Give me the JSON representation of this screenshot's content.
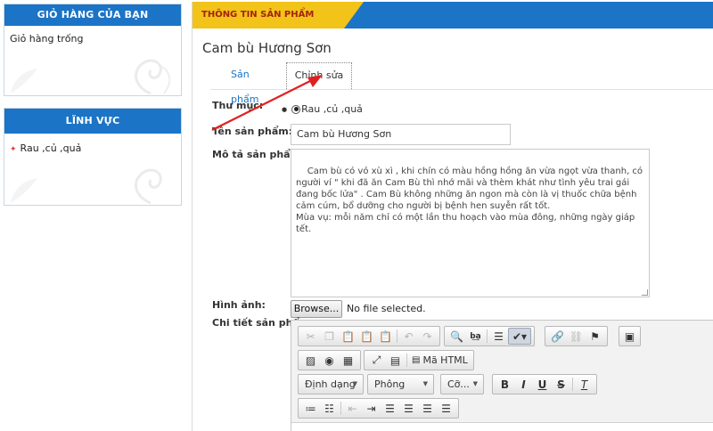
{
  "sidebar": {
    "cart": {
      "title": "GIỎ HÀNG CỦA BẠN",
      "empty_text": "Giỏ hàng trống"
    },
    "fields": {
      "title": "LĨNH VỰC",
      "items": [
        {
          "label": "Rau ,củ ,quả"
        }
      ]
    }
  },
  "main": {
    "header_tab": "THÔNG TIN SẢN PHẨM",
    "product_title": "Cam bù Hương Sơn",
    "tabs": [
      {
        "label": "Sản phẩm"
      },
      {
        "label": "Chỉnh sửa"
      }
    ],
    "form": {
      "category_label": "Thư mục:",
      "category_option": "Rau ,củ ,quả",
      "name_label": "Tên sản phẩm:",
      "name_value": "Cam bù Hương Sơn",
      "desc_label": "Mô tả sản phẩm:",
      "desc_value": "Cam bù có vỏ xù xì , khi chín có màu hồng hồng ăn vừa ngọt vừa thanh, có người ví \" khi đã ăn Cam Bù thì nhớ mãi và thèm khát như tình yêu trai gái đang bốc lửa\" . Cam Bù không những ăn ngon mà còn là vị thuốc chữa bệnh cảm cúm, bổ dưỡng cho người bị bệnh hen suyễn rất tốt.\nMùa vụ: mỗi năm chỉ có một lần thu hoạch vào mùa đông, những ngày giáp tết.",
      "image_label": "Hình ảnh:",
      "browse_label": "Browse...",
      "no_file_text": "No file selected.",
      "detail_label": "Chi tiết sản phẩm:"
    },
    "editor": {
      "source_label": "Mã HTML",
      "format_label": "Định dạng",
      "font_label": "Phông",
      "size_label": "Cỡ...",
      "bold": "B",
      "italic": "I",
      "underline": "U",
      "strike": "S",
      "remove_format": "T"
    }
  },
  "colors": {
    "accent_blue": "#1b74c6",
    "header_yellow": "#f2c319",
    "header_text": "#a5230f",
    "annotation_arrow": "#e02020"
  }
}
